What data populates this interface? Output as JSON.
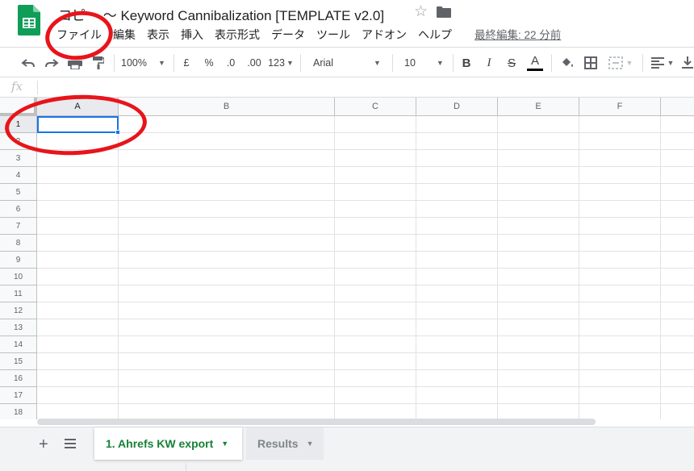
{
  "app": {
    "document_title": "コピー 〜 Keyword Cannibalization [TEMPLATE v2.0]",
    "last_edit": "最終編集: 22 分前"
  },
  "menu": {
    "items": [
      "ファイル",
      "編集",
      "表示",
      "挿入",
      "表示形式",
      "データ",
      "ツール",
      "アドオン",
      "ヘルプ"
    ]
  },
  "toolbar": {
    "zoom": "100%",
    "currency": "£",
    "percent": "%",
    "decimal_decrease": ".0",
    "decimal_increase": ".00",
    "more_formats": "123",
    "font": "Arial",
    "font_size": "10",
    "bold": "B",
    "italic": "I",
    "strike": "S",
    "text_color": "A"
  },
  "formula_bar": {
    "fx": "fx"
  },
  "grid": {
    "columns": [
      "A",
      "B",
      "C",
      "D",
      "E",
      "F"
    ],
    "rows": [
      "1",
      "2",
      "3",
      "4",
      "5",
      "6",
      "7",
      "8",
      "9",
      "10",
      "11",
      "12",
      "13",
      "14",
      "15",
      "16",
      "17",
      "18"
    ],
    "active_cell": "A1"
  },
  "sheets": {
    "tabs": [
      {
        "label": "1. Ahrefs KW export",
        "active": true
      },
      {
        "label": "Results",
        "active": false
      }
    ],
    "add": "+"
  },
  "colors": {
    "accent": "#1a73e8",
    "sheets_green": "#0f9d58",
    "active_tab": "#188038",
    "annotation_red": "#e8141b"
  }
}
